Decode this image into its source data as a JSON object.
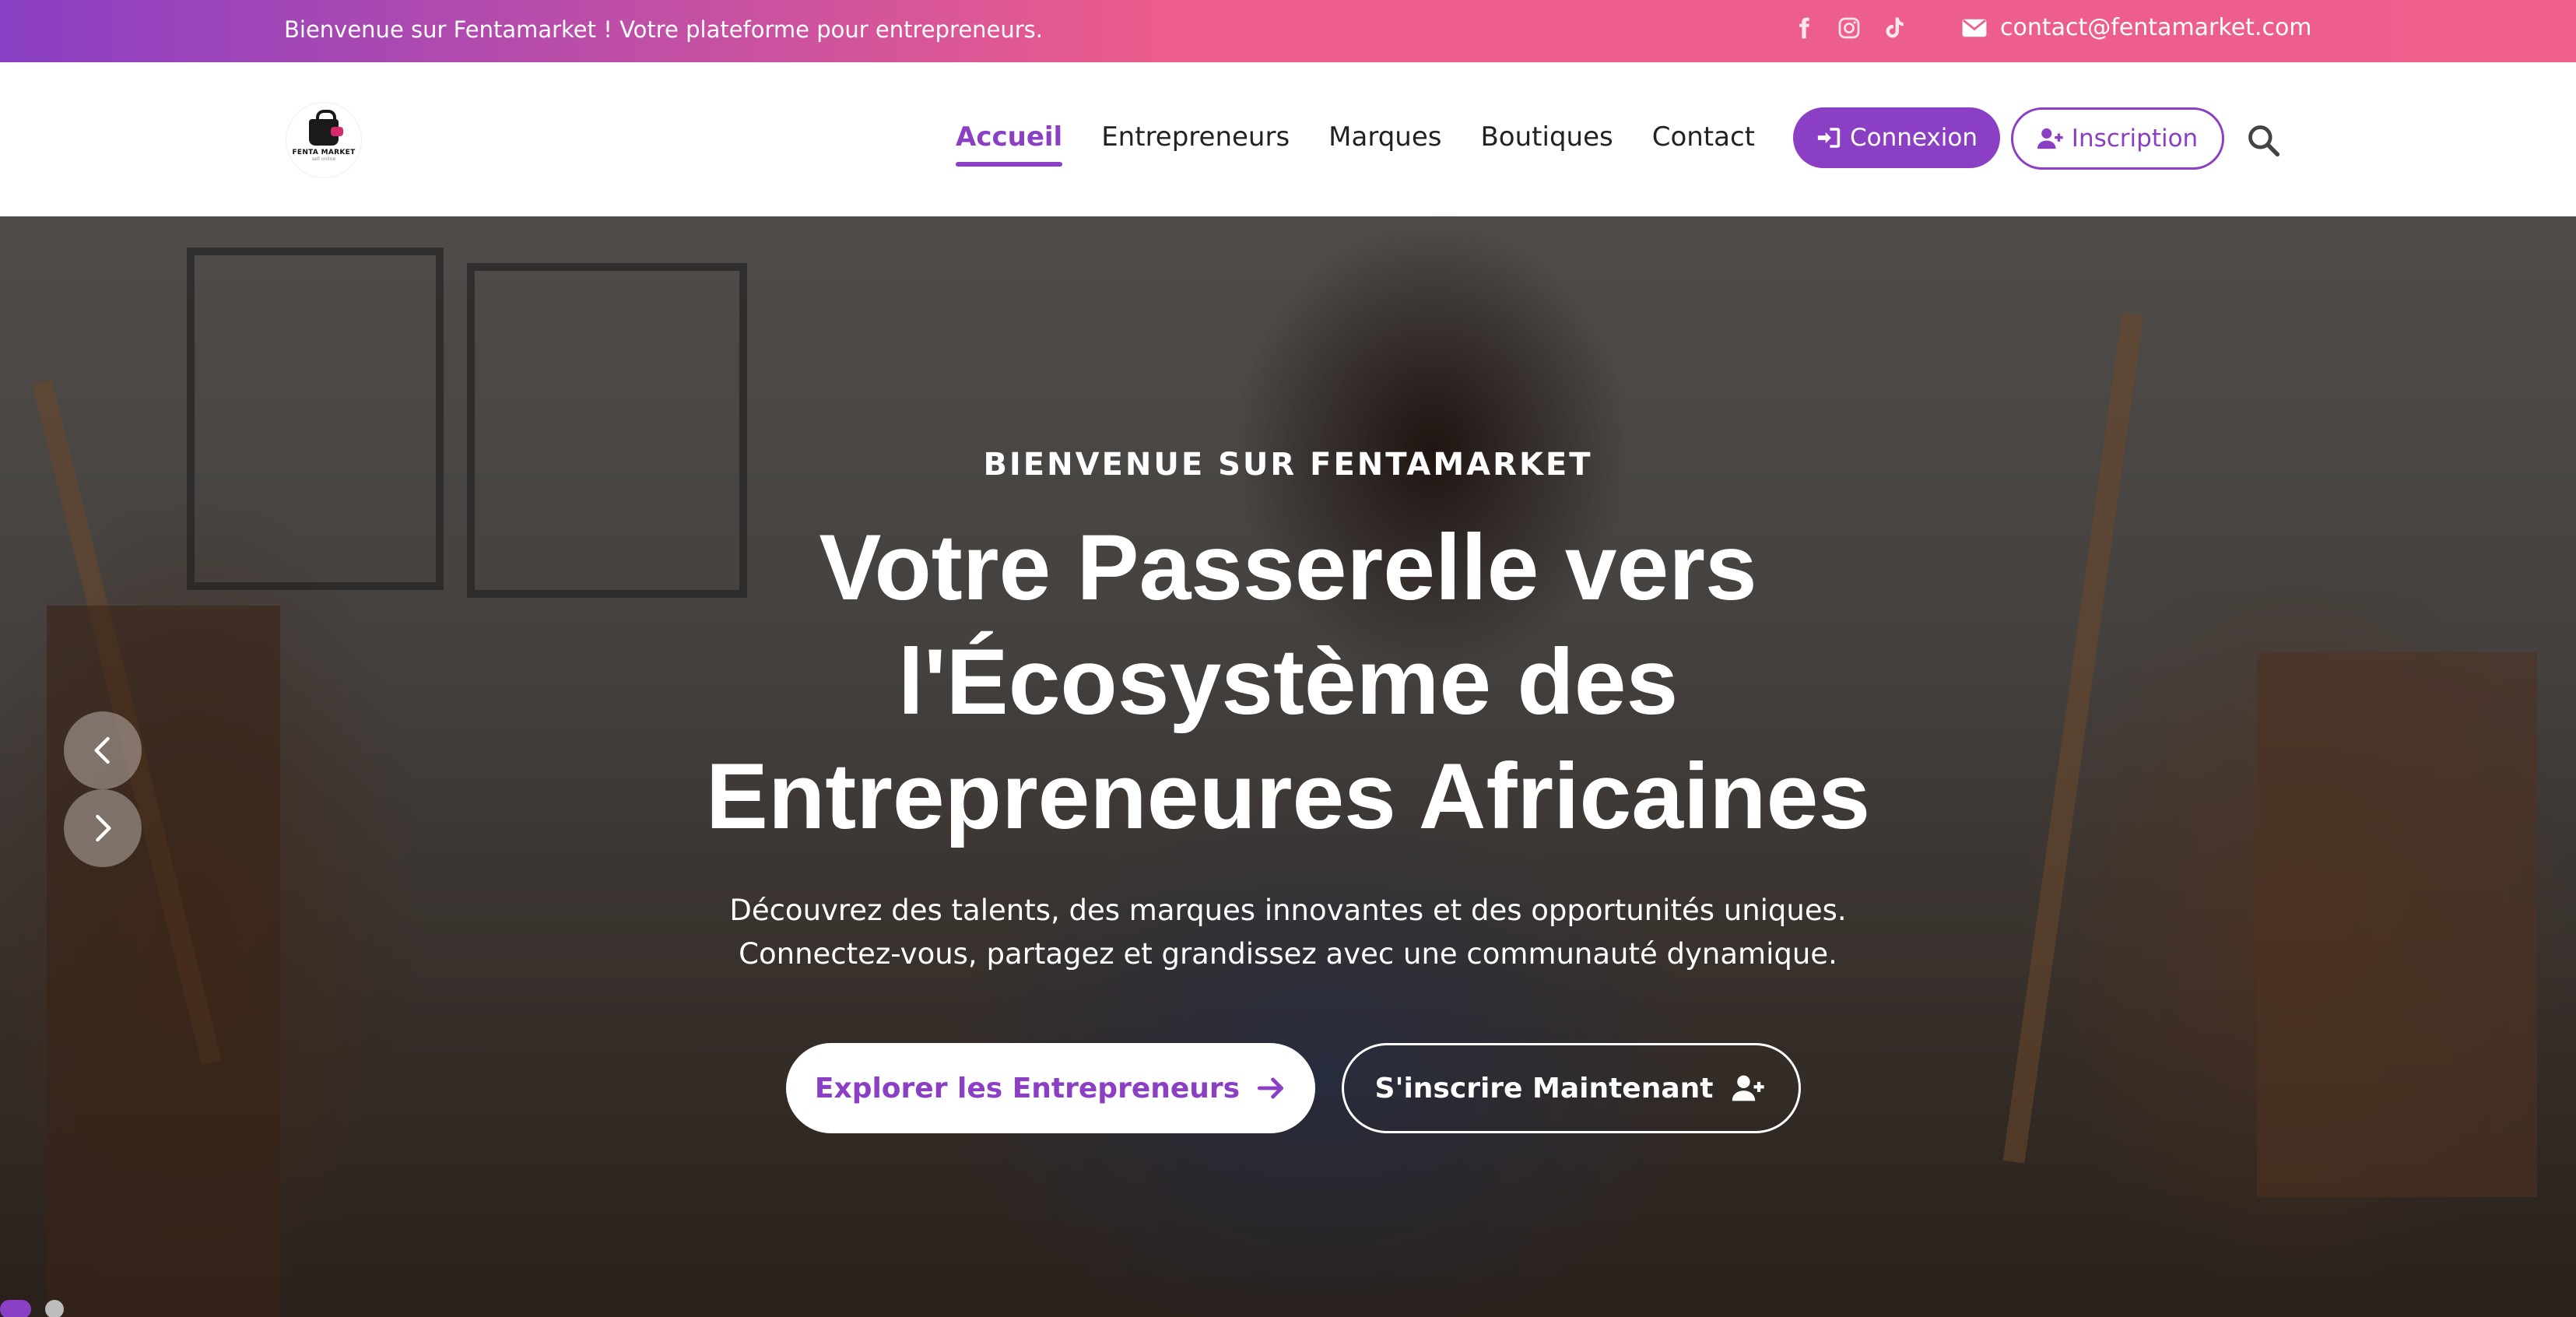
{
  "topbar": {
    "welcome": "Bienvenue sur Fentamarket ! Votre plateforme pour entrepreneurs.",
    "socials": [
      "facebook-icon",
      "instagram-icon",
      "tiktok-icon"
    ],
    "email": "contact@fentamarket.com"
  },
  "header": {
    "logo_text": "FENTA MARKET",
    "logo_subtext": "sell online",
    "nav": [
      "Accueil",
      "Entrepreneurs",
      "Marques",
      "Boutiques",
      "Contact"
    ],
    "active_nav": "Accueil",
    "login_label": "Connexion",
    "signup_label": "Inscription"
  },
  "hero": {
    "eyebrow": "BIENVENUE SUR FENTAMARKET",
    "title_line1": "Votre Passerelle vers",
    "title_line2": "l'Écosystème des",
    "title_line3": "Entrepreneures Africaines",
    "desc_line1": "Découvrez des talents, des marques innovantes et des opportunités uniques.",
    "desc_line2": "Connectez-vous, partagez et grandissez avec une communauté dynamique.",
    "cta_primary": "Explorer les Entrepreneurs",
    "cta_secondary": "S'inscrire Maintenant",
    "slides_count": 2,
    "active_slide": 1
  },
  "colors": {
    "accent": "#8a3fc4",
    "gradient_start": "#8a3fc4",
    "gradient_end": "#ee5f8c"
  }
}
